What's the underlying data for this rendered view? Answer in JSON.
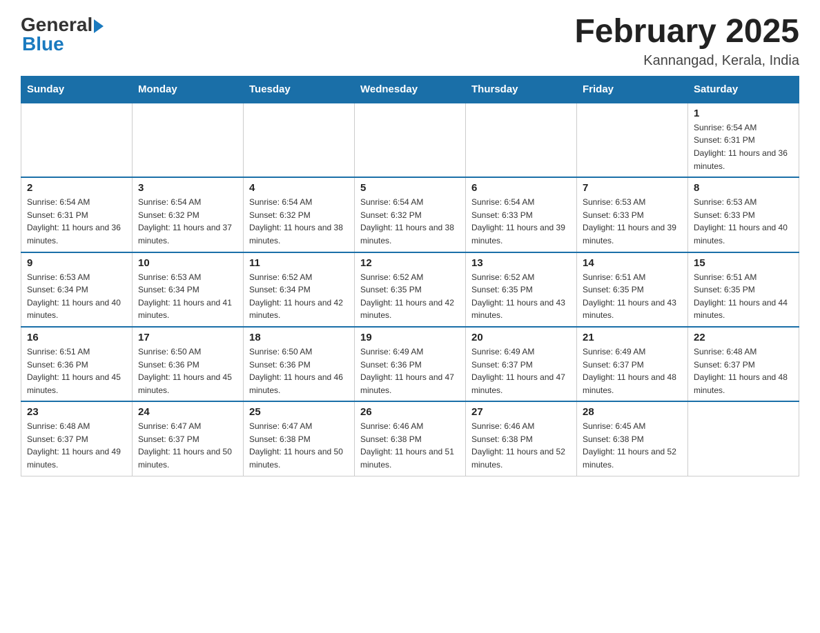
{
  "logo": {
    "general": "General",
    "blue": "Blue"
  },
  "title": "February 2025",
  "location": "Kannangad, Kerala, India",
  "days_of_week": [
    "Sunday",
    "Monday",
    "Tuesday",
    "Wednesday",
    "Thursday",
    "Friday",
    "Saturday"
  ],
  "weeks": [
    [
      {
        "day": "",
        "sunrise": "",
        "sunset": "",
        "daylight": ""
      },
      {
        "day": "",
        "sunrise": "",
        "sunset": "",
        "daylight": ""
      },
      {
        "day": "",
        "sunrise": "",
        "sunset": "",
        "daylight": ""
      },
      {
        "day": "",
        "sunrise": "",
        "sunset": "",
        "daylight": ""
      },
      {
        "day": "",
        "sunrise": "",
        "sunset": "",
        "daylight": ""
      },
      {
        "day": "",
        "sunrise": "",
        "sunset": "",
        "daylight": ""
      },
      {
        "day": "1",
        "sunrise": "Sunrise: 6:54 AM",
        "sunset": "Sunset: 6:31 PM",
        "daylight": "Daylight: 11 hours and 36 minutes."
      }
    ],
    [
      {
        "day": "2",
        "sunrise": "Sunrise: 6:54 AM",
        "sunset": "Sunset: 6:31 PM",
        "daylight": "Daylight: 11 hours and 36 minutes."
      },
      {
        "day": "3",
        "sunrise": "Sunrise: 6:54 AM",
        "sunset": "Sunset: 6:32 PM",
        "daylight": "Daylight: 11 hours and 37 minutes."
      },
      {
        "day": "4",
        "sunrise": "Sunrise: 6:54 AM",
        "sunset": "Sunset: 6:32 PM",
        "daylight": "Daylight: 11 hours and 38 minutes."
      },
      {
        "day": "5",
        "sunrise": "Sunrise: 6:54 AM",
        "sunset": "Sunset: 6:32 PM",
        "daylight": "Daylight: 11 hours and 38 minutes."
      },
      {
        "day": "6",
        "sunrise": "Sunrise: 6:54 AM",
        "sunset": "Sunset: 6:33 PM",
        "daylight": "Daylight: 11 hours and 39 minutes."
      },
      {
        "day": "7",
        "sunrise": "Sunrise: 6:53 AM",
        "sunset": "Sunset: 6:33 PM",
        "daylight": "Daylight: 11 hours and 39 minutes."
      },
      {
        "day": "8",
        "sunrise": "Sunrise: 6:53 AM",
        "sunset": "Sunset: 6:33 PM",
        "daylight": "Daylight: 11 hours and 40 minutes."
      }
    ],
    [
      {
        "day": "9",
        "sunrise": "Sunrise: 6:53 AM",
        "sunset": "Sunset: 6:34 PM",
        "daylight": "Daylight: 11 hours and 40 minutes."
      },
      {
        "day": "10",
        "sunrise": "Sunrise: 6:53 AM",
        "sunset": "Sunset: 6:34 PM",
        "daylight": "Daylight: 11 hours and 41 minutes."
      },
      {
        "day": "11",
        "sunrise": "Sunrise: 6:52 AM",
        "sunset": "Sunset: 6:34 PM",
        "daylight": "Daylight: 11 hours and 42 minutes."
      },
      {
        "day": "12",
        "sunrise": "Sunrise: 6:52 AM",
        "sunset": "Sunset: 6:35 PM",
        "daylight": "Daylight: 11 hours and 42 minutes."
      },
      {
        "day": "13",
        "sunrise": "Sunrise: 6:52 AM",
        "sunset": "Sunset: 6:35 PM",
        "daylight": "Daylight: 11 hours and 43 minutes."
      },
      {
        "day": "14",
        "sunrise": "Sunrise: 6:51 AM",
        "sunset": "Sunset: 6:35 PM",
        "daylight": "Daylight: 11 hours and 43 minutes."
      },
      {
        "day": "15",
        "sunrise": "Sunrise: 6:51 AM",
        "sunset": "Sunset: 6:35 PM",
        "daylight": "Daylight: 11 hours and 44 minutes."
      }
    ],
    [
      {
        "day": "16",
        "sunrise": "Sunrise: 6:51 AM",
        "sunset": "Sunset: 6:36 PM",
        "daylight": "Daylight: 11 hours and 45 minutes."
      },
      {
        "day": "17",
        "sunrise": "Sunrise: 6:50 AM",
        "sunset": "Sunset: 6:36 PM",
        "daylight": "Daylight: 11 hours and 45 minutes."
      },
      {
        "day": "18",
        "sunrise": "Sunrise: 6:50 AM",
        "sunset": "Sunset: 6:36 PM",
        "daylight": "Daylight: 11 hours and 46 minutes."
      },
      {
        "day": "19",
        "sunrise": "Sunrise: 6:49 AM",
        "sunset": "Sunset: 6:36 PM",
        "daylight": "Daylight: 11 hours and 47 minutes."
      },
      {
        "day": "20",
        "sunrise": "Sunrise: 6:49 AM",
        "sunset": "Sunset: 6:37 PM",
        "daylight": "Daylight: 11 hours and 47 minutes."
      },
      {
        "day": "21",
        "sunrise": "Sunrise: 6:49 AM",
        "sunset": "Sunset: 6:37 PM",
        "daylight": "Daylight: 11 hours and 48 minutes."
      },
      {
        "day": "22",
        "sunrise": "Sunrise: 6:48 AM",
        "sunset": "Sunset: 6:37 PM",
        "daylight": "Daylight: 11 hours and 48 minutes."
      }
    ],
    [
      {
        "day": "23",
        "sunrise": "Sunrise: 6:48 AM",
        "sunset": "Sunset: 6:37 PM",
        "daylight": "Daylight: 11 hours and 49 minutes."
      },
      {
        "day": "24",
        "sunrise": "Sunrise: 6:47 AM",
        "sunset": "Sunset: 6:37 PM",
        "daylight": "Daylight: 11 hours and 50 minutes."
      },
      {
        "day": "25",
        "sunrise": "Sunrise: 6:47 AM",
        "sunset": "Sunset: 6:38 PM",
        "daylight": "Daylight: 11 hours and 50 minutes."
      },
      {
        "day": "26",
        "sunrise": "Sunrise: 6:46 AM",
        "sunset": "Sunset: 6:38 PM",
        "daylight": "Daylight: 11 hours and 51 minutes."
      },
      {
        "day": "27",
        "sunrise": "Sunrise: 6:46 AM",
        "sunset": "Sunset: 6:38 PM",
        "daylight": "Daylight: 11 hours and 52 minutes."
      },
      {
        "day": "28",
        "sunrise": "Sunrise: 6:45 AM",
        "sunset": "Sunset: 6:38 PM",
        "daylight": "Daylight: 11 hours and 52 minutes."
      },
      {
        "day": "",
        "sunrise": "",
        "sunset": "",
        "daylight": ""
      }
    ]
  ]
}
